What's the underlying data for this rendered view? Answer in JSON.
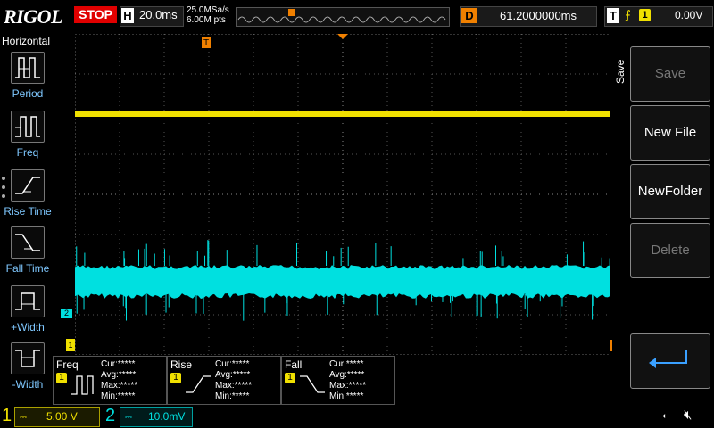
{
  "header": {
    "brand": "RIGOL",
    "run_state": "STOP",
    "timebase_label": "H",
    "timebase_value": "20.0ms",
    "sample_rate": "25.0MSa/s",
    "memory_depth": "6.00M pts",
    "delay_label": "D",
    "delay_value": "61.2000000ms",
    "trigger_label": "T",
    "trigger_edge": "rising-edge-icon",
    "trigger_source": "1",
    "trigger_level": "0.00V"
  },
  "left_menu": {
    "title": "Horizontal",
    "items": [
      {
        "label": "Period",
        "icon": "period-icon"
      },
      {
        "label": "Freq",
        "icon": "frequency-icon"
      },
      {
        "label": "Rise Time",
        "icon": "rise-time-icon"
      },
      {
        "label": "Fall Time",
        "icon": "fall-time-icon"
      },
      {
        "label": "+Width",
        "icon": "positive-width-icon"
      },
      {
        "label": "-Width",
        "icon": "negative-width-icon"
      }
    ]
  },
  "right_menu": {
    "title": "Save",
    "buttons": [
      {
        "label": "Save",
        "enabled": false
      },
      {
        "label": "New File",
        "enabled": true
      },
      {
        "label": "NewFolder",
        "enabled": true
      },
      {
        "label": "Delete",
        "enabled": false
      }
    ],
    "back_icon": "return-arrow-icon"
  },
  "measurements": [
    {
      "name": "Freq",
      "channel": "1",
      "cur": "Cur:*****",
      "avg": "Avg:*****",
      "max": "Max:*****",
      "min": "Min:*****"
    },
    {
      "name": "Rise",
      "channel": "1",
      "cur": "Cur:*****",
      "avg": "Avg:*****",
      "max": "Max:*****",
      "min": "Min:*****"
    },
    {
      "name": "Fall",
      "channel": "1",
      "cur": "Cur:*****",
      "avg": "Avg:*****",
      "max": "Max:*****",
      "min": "Min:*****"
    }
  ],
  "channels": {
    "ch1": {
      "number": "1",
      "scale": "5.00 V",
      "color": "#f0e000"
    },
    "ch2": {
      "number": "2",
      "scale": "10.0mV",
      "color": "#00e0e0"
    }
  },
  "waveform": {
    "ch2_marker": "2",
    "ch1_marker": "1",
    "trigger_marker": "T"
  },
  "status_icons": {
    "usb": "usb-icon",
    "speaker": "speaker-muted-icon"
  }
}
